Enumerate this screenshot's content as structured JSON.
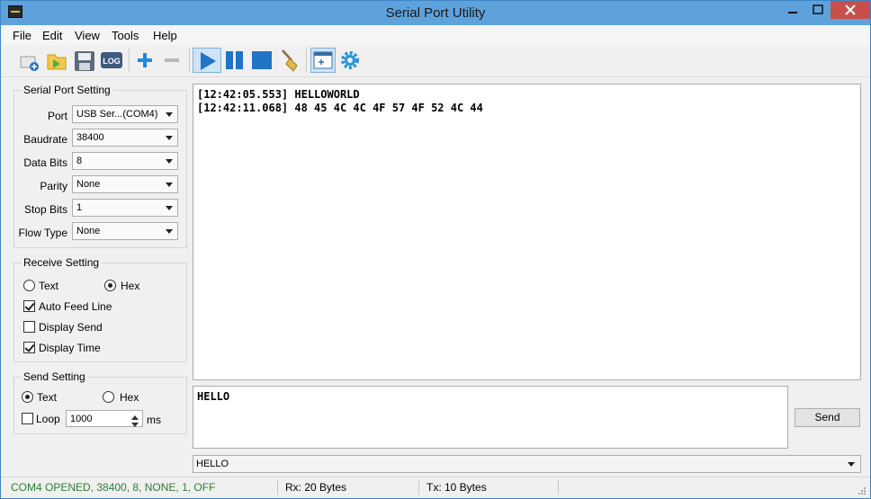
{
  "window": {
    "title": "Serial Port Utility"
  },
  "menu": {
    "items": [
      "File",
      "Edit",
      "View",
      "Tools",
      "Help"
    ]
  },
  "toolbar": {
    "log_label": "LOG"
  },
  "serial_setting": {
    "title": "Serial Port Setting",
    "fields": [
      {
        "label": "Port",
        "value": "USB Ser...(COM4)"
      },
      {
        "label": "Baudrate",
        "value": "38400"
      },
      {
        "label": "Data Bits",
        "value": "8"
      },
      {
        "label": "Parity",
        "value": "None"
      },
      {
        "label": "Stop Bits",
        "value": "1"
      },
      {
        "label": "Flow Type",
        "value": "None"
      }
    ]
  },
  "receive_setting": {
    "title": "Receive Setting",
    "text_label": "Text",
    "hex_label": "Hex",
    "auto_feed_label": "Auto Feed Line",
    "display_send_label": "Display Send",
    "display_time_label": "Display Time"
  },
  "send_setting": {
    "title": "Send Setting",
    "text_label": "Text",
    "hex_label": "Hex",
    "loop_label": "Loop",
    "loop_value": "1000",
    "unit": "ms"
  },
  "receive": {
    "lines": [
      "[12:42:05.553] HELLOWORLD",
      "[12:42:11.068] 48 45 4C 4C 4F 57 4F 52 4C 44"
    ]
  },
  "send": {
    "value": "HELLO",
    "button_label": "Send"
  },
  "history": {
    "value": "HELLO"
  },
  "status": {
    "connection": "COM4 OPENED, 38400, 8, NONE, 1, OFF",
    "rx": "Rx: 20 Bytes",
    "tx": "Tx: 10 Bytes"
  },
  "colors": {
    "status_ok": "#2e7d32",
    "titlebar": "#5ea2dc",
    "accent": "#1f74c6"
  }
}
